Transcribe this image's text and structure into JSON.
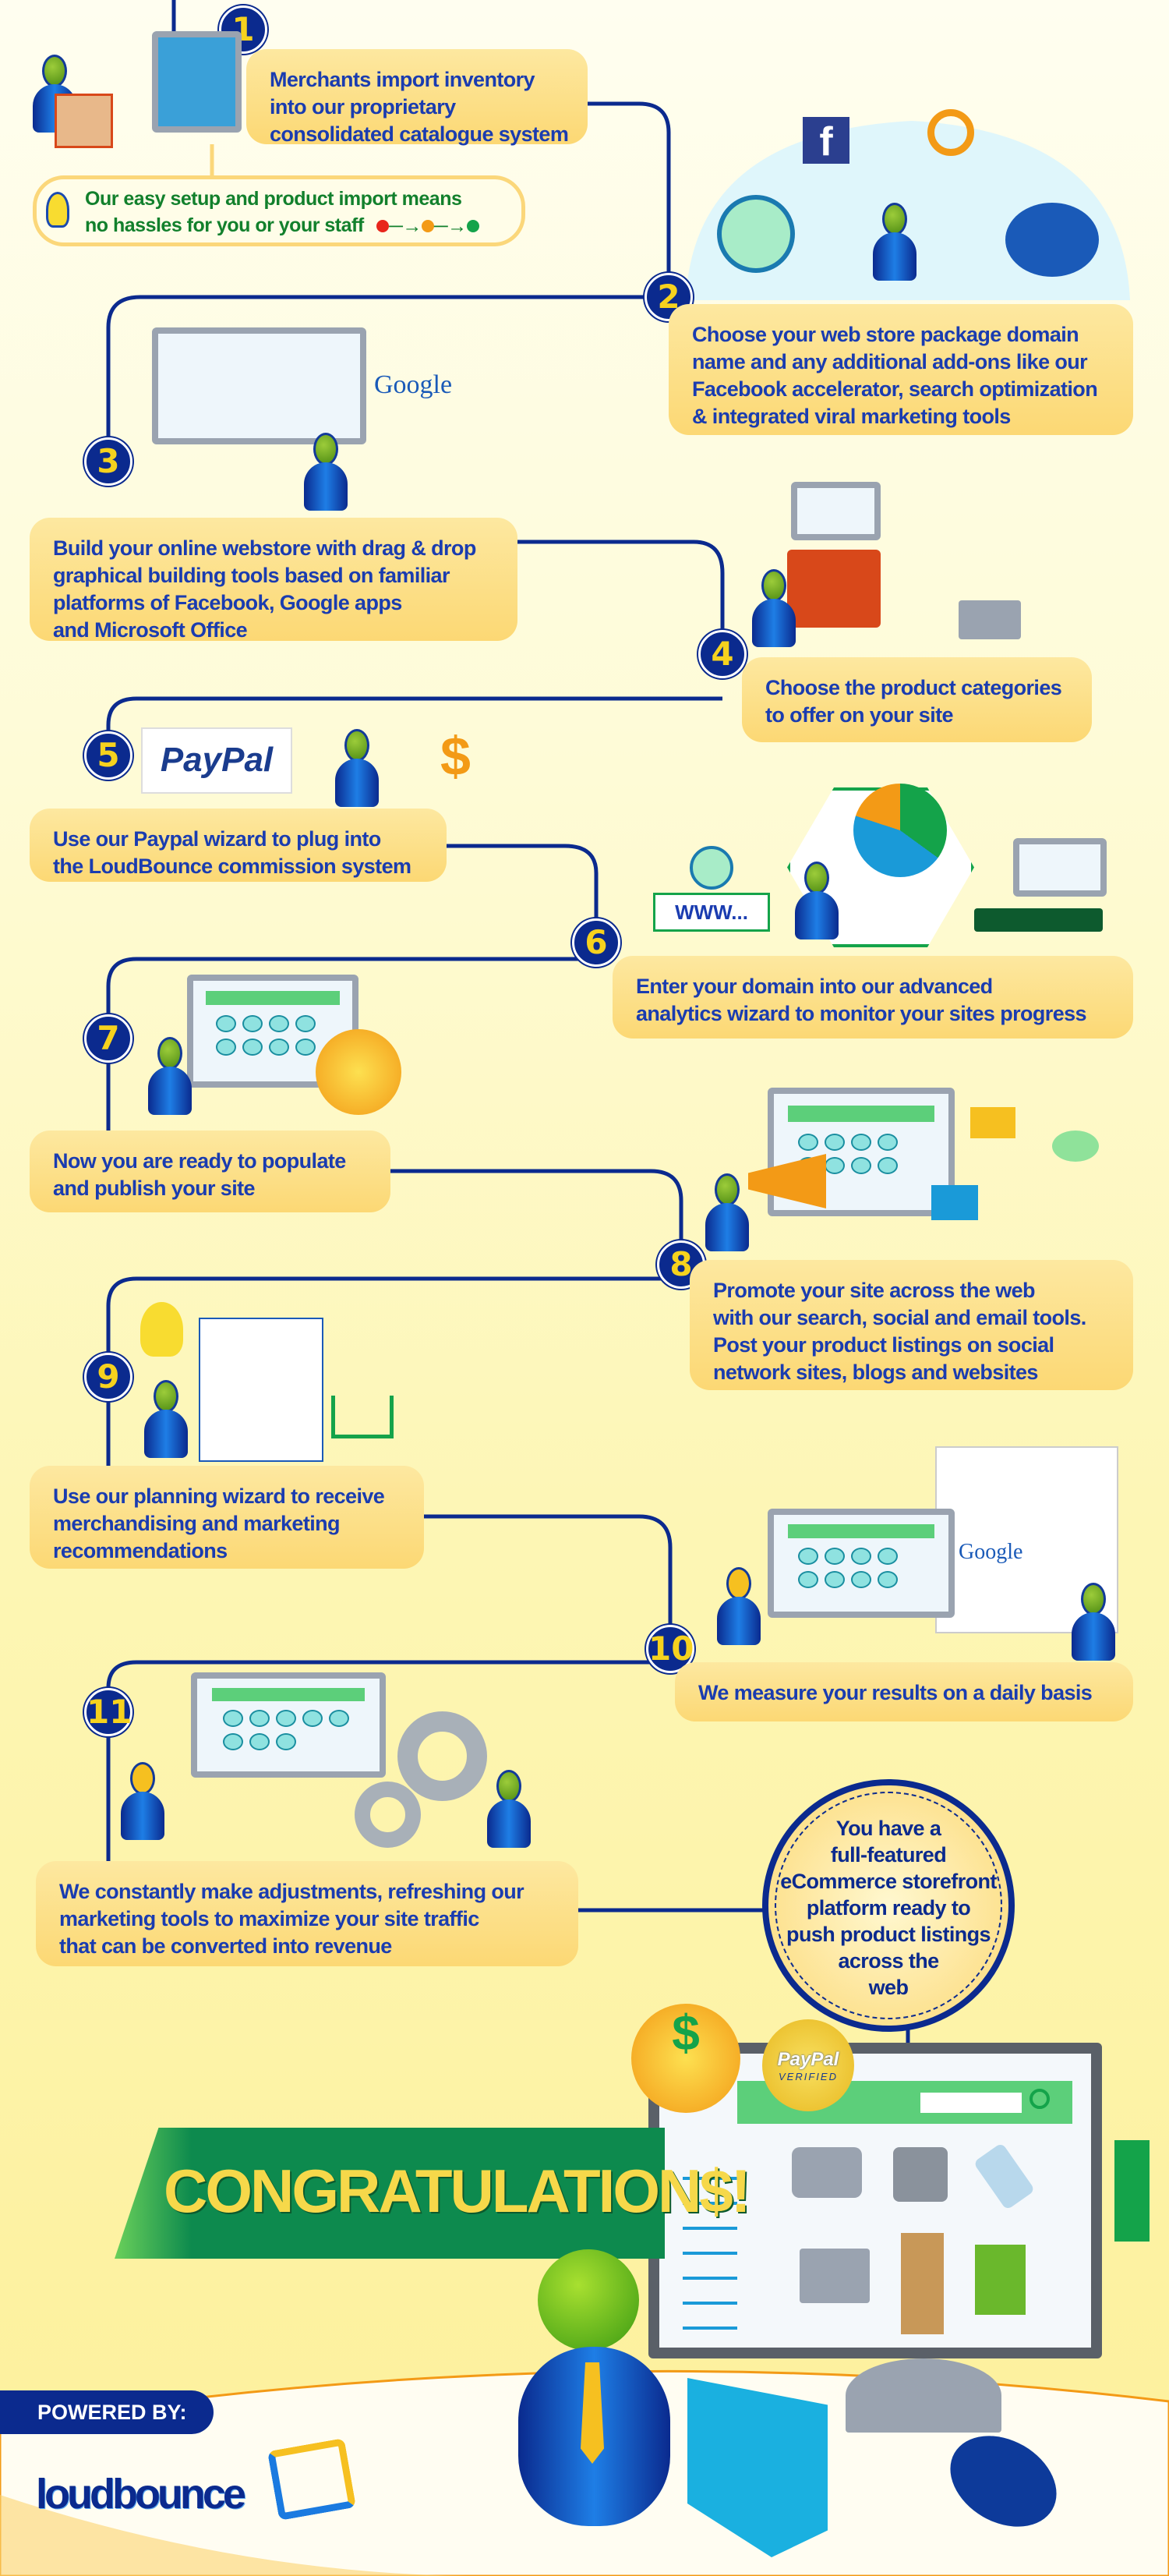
{
  "steps": [
    {
      "number": "1",
      "lines": [
        "Merchants import inventory",
        "into our proprietary",
        "consolidated catalogue system"
      ]
    },
    {
      "number": "2",
      "lines": [
        "Choose your web store package domain",
        "name and any additional add-ons like our",
        "Facebook accelerator, search optimization",
        "& integrated viral marketing tools"
      ]
    },
    {
      "number": "3",
      "lines": [
        "Build your online webstore with drag & drop",
        "graphical building tools based on familiar",
        "platforms of Facebook, Google apps",
        "and Microsoft Office"
      ]
    },
    {
      "number": "4",
      "lines": [
        "Choose the product categories",
        "to offer on your site"
      ]
    },
    {
      "number": "5",
      "lines": [
        "Use our Paypal wizard to plug into",
        "the LoudBounce commission system"
      ]
    },
    {
      "number": "6",
      "lines": [
        "Enter your domain into our advanced",
        "analytics wizard to monitor your sites progress"
      ]
    },
    {
      "number": "7",
      "lines": [
        "Now you are ready to populate",
        "and publish your site"
      ]
    },
    {
      "number": "8",
      "lines": [
        "Promote your site across the web",
        "with our search, social and email tools.",
        "Post your product listings on social",
        "network sites, blogs and websites"
      ]
    },
    {
      "number": "9",
      "lines": [
        "Use our planning wizard to receive",
        "merchandising and marketing",
        "recommendations"
      ]
    },
    {
      "number": "10",
      "lines": [
        "We measure your results on a daily basis"
      ]
    },
    {
      "number": "11",
      "lines": [
        "We constantly make adjustments, refreshing our",
        "marketing tools to maximize your site traffic",
        "that can be converted into revenue"
      ]
    }
  ],
  "tip": {
    "lines": [
      "Our easy setup and product import means",
      "no hassles for you or your staff"
    ],
    "icon": "lightbulb-icon",
    "dots": [
      "#e8261c",
      "#f39a16",
      "#14a34a"
    ]
  },
  "final": {
    "lines": [
      "You have a",
      "full-featured",
      "eCommerce storefront",
      "platform ready to",
      "push product listings",
      "across the",
      "web"
    ]
  },
  "banner": {
    "text": "CONGRATULATION$!"
  },
  "footer": {
    "powered_by": "POWERED BY:",
    "logo": "loudbounce"
  },
  "logos": {
    "paypal": "PayPal",
    "paypal_verified_top": "PayPal",
    "paypal_verified_bottom": "VERIFIED",
    "google": "Google",
    "facebook": "f",
    "www": "WWW...",
    "dollar": "$"
  },
  "colors": {
    "text": "#1a3cb0",
    "tip_text": "#12802c",
    "box": "#fcd874",
    "connector": "#0b2a8e",
    "number": "#f6d21e",
    "banner": "#0d8a4e",
    "banner_text": "#f6d84a"
  }
}
